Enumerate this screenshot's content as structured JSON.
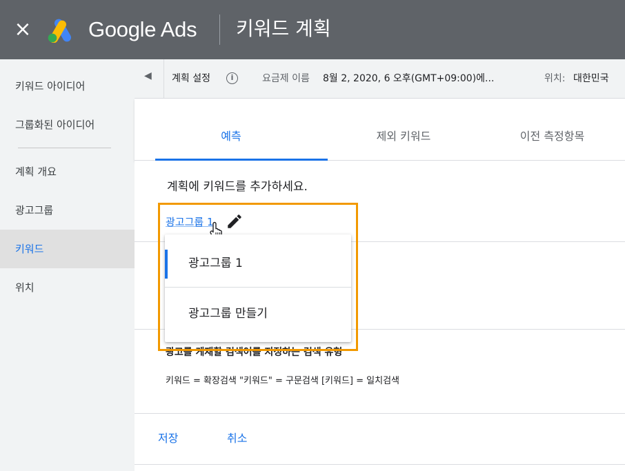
{
  "header": {
    "close_glyph": "×",
    "brand": "Google Ads",
    "title": "키워드 계획",
    "colors": {
      "background": "#5f6368",
      "logo_blue": "#4285f4",
      "logo_yellow": "#fbbc04",
      "logo_green": "#34a853"
    }
  },
  "sidebar": {
    "items": [
      {
        "label": "키워드 아이디어"
      },
      {
        "label": "그룹화된 아이디어"
      },
      {
        "label": "계획 개요"
      },
      {
        "label": "광고그룹"
      },
      {
        "label": "키워드",
        "active": true
      },
      {
        "label": "위치"
      }
    ]
  },
  "settings_bar": {
    "collapse_glyph": "◀",
    "plan_settings": "계획 설정",
    "info_glyph": "i",
    "rate_label": "요금제 이름",
    "rate_value": "8월 2, 2020, 6 오후(GMT+09:00)에...",
    "location_label": "위치:",
    "location_value": "대한민국"
  },
  "tabs": [
    {
      "label": "예측",
      "selected": true
    },
    {
      "label": "제외 키워드"
    },
    {
      "label": "이전 측정항목"
    }
  ],
  "content": {
    "add_keywords_title": "계획에 키워드를 추가하세요.",
    "ad_group_link": "광고그룹 1",
    "match_type_title": "광고를 게재할 검색어를 지정하는 검색 유형",
    "match_type_desc": "키워드 = 확장검색   \"키워드\" = 구문검색   [키워드] = 일치검색",
    "save_label": "저장",
    "cancel_label": "취소"
  },
  "dropdown": {
    "options": [
      "광고그룹 1",
      "광고그룹 만들기"
    ],
    "selected_index": 0
  },
  "accent_colors": {
    "primary": "#1a73e8",
    "highlight": "#f29900"
  },
  "icons": [
    "close-icon",
    "google-ads-logo-icon",
    "collapse-arrow-icon",
    "info-icon",
    "pencil-icon",
    "hand-cursor-icon"
  ]
}
